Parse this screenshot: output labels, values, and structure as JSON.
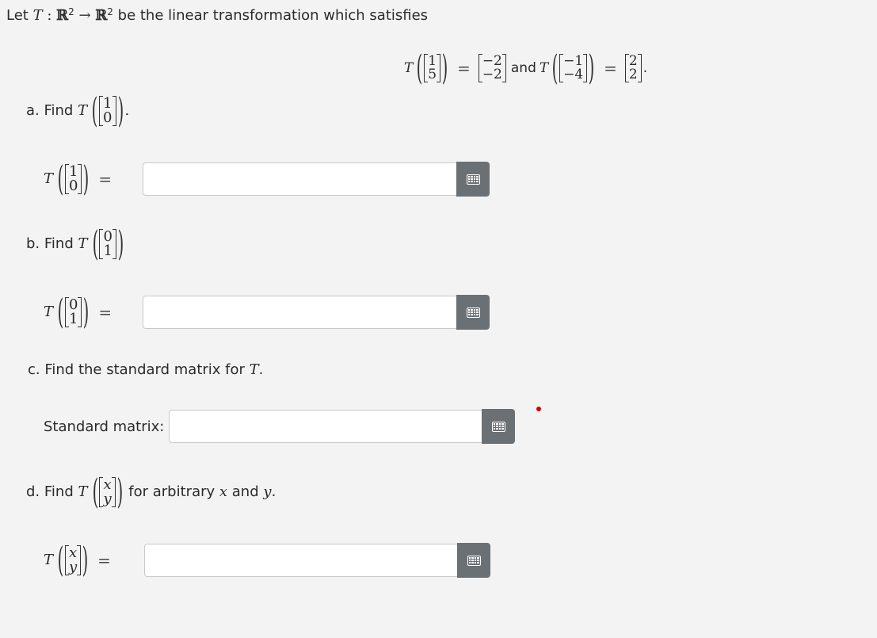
{
  "header": {
    "intro_pre": "Let",
    "T": "T",
    "colon": ":",
    "R": "ℝ",
    "exp": "2",
    "arrow": "→",
    "intro_post": "be the linear transformation which satisfies",
    "and": "and"
  },
  "given": {
    "v1": [
      "1",
      "5"
    ],
    "w1": [
      "−2",
      "−2"
    ],
    "v2": [
      "−1",
      "−4"
    ],
    "w2": [
      "2",
      "2"
    ]
  },
  "parts": {
    "a": {
      "prefix": "a. Find",
      "vec": [
        "1",
        "0"
      ],
      "suffix": "."
    },
    "b": {
      "prefix": "b. Find",
      "vec": [
        "0",
        "1"
      ]
    },
    "c": {
      "text_pre": "c. Find the standard matrix for",
      "text_post": ".",
      "field_label": "Standard matrix:"
    },
    "d": {
      "prefix": "d. Find",
      "vec": [
        "x",
        "y"
      ],
      "suffix_pre": "for arbitrary",
      "x": "x",
      "and": "and",
      "y": "y",
      "period": "."
    }
  },
  "answers": {
    "a": "",
    "b": "",
    "c": "",
    "d": ""
  },
  "colors": {
    "button": "#6b7075",
    "border": "#c9c9c9",
    "background": "#f3f3f3",
    "dot": "#dd0000"
  },
  "icons": {
    "keyboard": "keyboard-icon"
  }
}
